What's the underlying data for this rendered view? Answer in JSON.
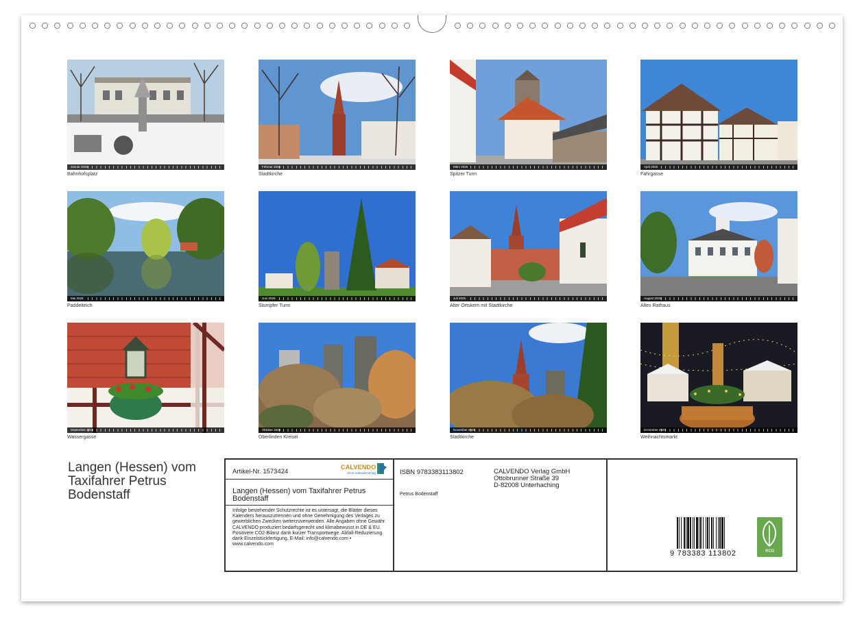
{
  "calendar": {
    "title": "Langen (Hessen) vom Taxifahrer Petrus Bodenstaff",
    "months": [
      {
        "label": "Januar 2025",
        "caption": "Bahnhofsplatz",
        "scene": "snow-square"
      },
      {
        "label": "Februar 2025",
        "caption": "Stadtkirche",
        "scene": "church-winter"
      },
      {
        "label": "März 2025",
        "caption": "Spitzer Turm",
        "scene": "tower-house"
      },
      {
        "label": "April 2025",
        "caption": "Fahrgasse",
        "scene": "timber-houses"
      },
      {
        "label": "Mai 2025",
        "caption": "Paddelteich",
        "scene": "pond"
      },
      {
        "label": "Juni 2025",
        "caption": "Stumpfer Turm",
        "scene": "round-tower"
      },
      {
        "label": "Juli 2025",
        "caption": "Alter Ortskern mit Stadtkirche",
        "scene": "old-town"
      },
      {
        "label": "August 2025",
        "caption": "Altes Rathaus",
        "scene": "town-hall"
      },
      {
        "label": "September 2025",
        "caption": "Wassergasse",
        "scene": "lantern"
      },
      {
        "label": "Oktober 2025",
        "caption": "Oberlinden Kreisel",
        "scene": "grasses"
      },
      {
        "label": "November 2025",
        "caption": "Stadtkirche",
        "scene": "church-autumn"
      },
      {
        "label": "Dezember 2025",
        "caption": "Weihnachtsmarkt",
        "scene": "christmas-market"
      }
    ]
  },
  "info": {
    "article": "Artikel-Nr. 1573424",
    "logo": "CALVENDO",
    "logo_sub": "Dein Kalenderverlag",
    "product_title": "Langen (Hessen) vom Taxifahrer Petrus Bodenstaff",
    "legal": "Infolge bestehender Schutzrechte ist es untersagt, die Blätter dieses Kalenders herauszutrennen und ohne Genehmigung des Verlages zu gewerblichen Zwecken weiterzuverwenden. Alle Angaben ohne Gewähr. CALVENDO produziert bedarfsgerecht und klimabewusst in DE & EU. Positivere CO2-Bilanz dank kurzer Transportwege. Abfall-Reduzierung dank Einzelstückfertigung. E-Mail: info@calvendo.com • www.calvendo.com",
    "isbn": "ISBN 9783383113802",
    "author": "Petrus Bodenstaff",
    "publisher": [
      "CALVENDO Verlag GmbH",
      "Ottobrunner Straße 39",
      "D-82008 Unterhaching"
    ],
    "barcode_number": "9 783383 113802",
    "eco_label": "eco"
  },
  "colors": {
    "sky": "#3f86d6",
    "frame": "#333333",
    "logo_orange": "#c98a10",
    "eco_green": "#6aa84f"
  }
}
